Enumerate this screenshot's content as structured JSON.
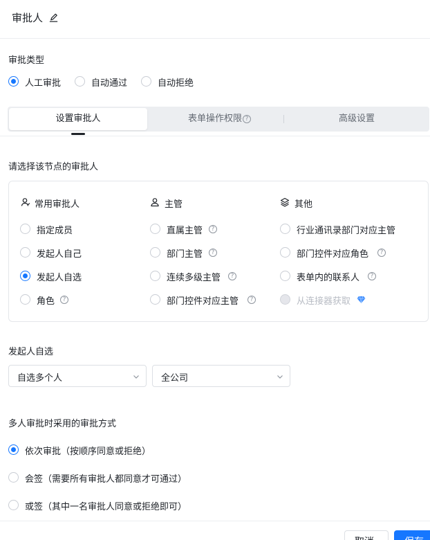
{
  "header": {
    "title": "审批人"
  },
  "approval_type": {
    "label": "审批类型",
    "options": [
      {
        "label": "人工审批",
        "checked": true
      },
      {
        "label": "自动通过",
        "checked": false
      },
      {
        "label": "自动拒绝",
        "checked": false
      }
    ]
  },
  "tabs": [
    {
      "label": "设置审批人",
      "active": true
    },
    {
      "label": "表单操作权限",
      "active": false
    },
    {
      "label": "高级设置",
      "active": false
    }
  ],
  "approver_section": {
    "label": "请选择该节点的审批人",
    "columns": [
      {
        "title": "常用审批人",
        "icon": "user-icon",
        "options": [
          {
            "label": "指定成员",
            "checked": false
          },
          {
            "label": "发起人自己",
            "checked": false
          },
          {
            "label": "发起人自选",
            "checked": true
          },
          {
            "label": "角色",
            "checked": false,
            "help": true
          }
        ]
      },
      {
        "title": "主管",
        "icon": "user-icon",
        "options": [
          {
            "label": "直属主管",
            "help": true
          },
          {
            "label": "部门主管",
            "help": true
          },
          {
            "label": "连续多级主管",
            "help": true
          },
          {
            "label": "部门控件对应主管",
            "help": true
          }
        ]
      },
      {
        "title": "其他",
        "icon": "layers-icon",
        "options": [
          {
            "label": "行业通讯录部门对应主管"
          },
          {
            "label": "部门控件对应角色",
            "help": true
          },
          {
            "label": "表单内的联系人",
            "help": true
          },
          {
            "label": "从连接器获取",
            "disabled": true,
            "gem": true
          }
        ]
      }
    ]
  },
  "self_select": {
    "label": "发起人自选",
    "mode_value": "自选多个人",
    "scope_value": "全公司"
  },
  "multi_mode": {
    "label": "多人审批时采用的审批方式",
    "options": [
      {
        "label": "依次审批（按顺序同意或拒绝）",
        "checked": true
      },
      {
        "label": "会签（需要所有审批人都同意才可通过）",
        "checked": false
      },
      {
        "label": "或签（其中一名审批人同意或拒绝即可）",
        "checked": false
      }
    ]
  },
  "footer": {
    "cancel_label": "取消",
    "save_label": "保存"
  },
  "colors": {
    "accent": "#1677ff",
    "gem": "#3b8cff"
  }
}
